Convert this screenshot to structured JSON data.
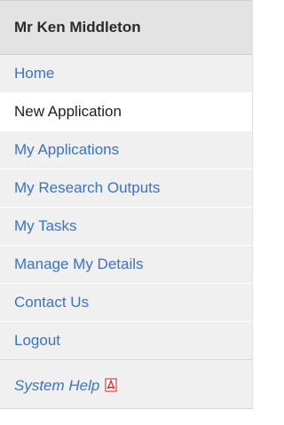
{
  "header": {
    "title": "Mr Ken Middleton"
  },
  "menu": {
    "items": [
      {
        "label": "Home",
        "active": false
      },
      {
        "label": "New Application",
        "active": true
      },
      {
        "label": "My Applications",
        "active": false
      },
      {
        "label": "My Research Outputs",
        "active": false
      },
      {
        "label": "My Tasks",
        "active": false
      },
      {
        "label": "Manage My Details",
        "active": false
      },
      {
        "label": "Contact Us",
        "active": false
      },
      {
        "label": "Logout",
        "active": false
      }
    ]
  },
  "help": {
    "label": "System Help",
    "icon": "pdf-icon"
  },
  "colors": {
    "link": "#3b73c5",
    "active_text": "#1e1e1e",
    "panel_bg": "#f0f0f0",
    "header_bg": "#e3e3e3",
    "pdf_red": "#d62020"
  }
}
